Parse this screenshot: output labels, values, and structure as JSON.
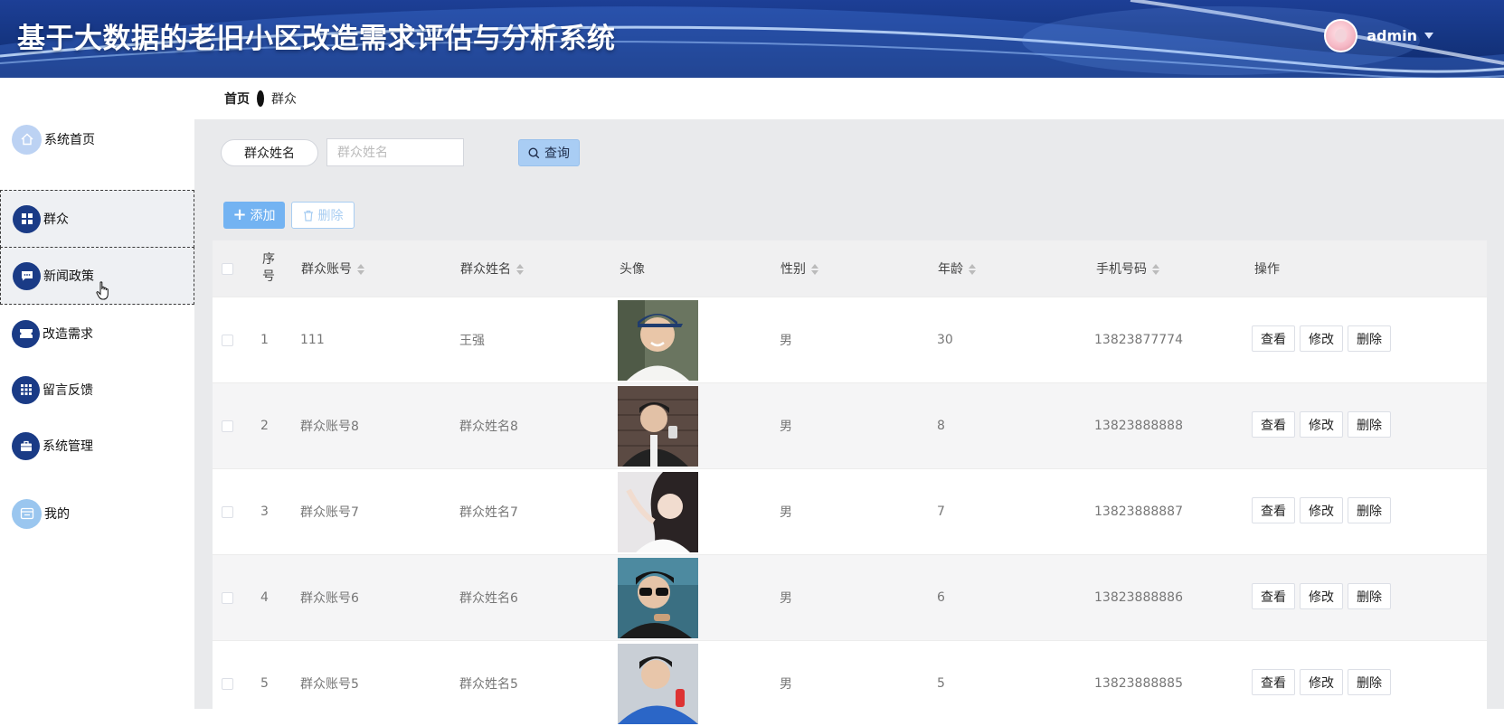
{
  "header": {
    "title": "基于大数据的老旧小区改造需求评估与分析系统",
    "username": "admin"
  },
  "sidebar": {
    "items": [
      {
        "label": "系统首页",
        "icon": "home-icon"
      },
      {
        "label": "群众",
        "icon": "grid-icon"
      },
      {
        "label": "新闻政策",
        "icon": "chat-icon"
      },
      {
        "label": "改造需求",
        "icon": "ticket-icon"
      },
      {
        "label": "留言反馈",
        "icon": "apps-icon"
      },
      {
        "label": "系统管理",
        "icon": "briefcase-icon"
      },
      {
        "label": "我的",
        "icon": "card-icon"
      }
    ]
  },
  "breadcrumb": {
    "home": "首页",
    "current": "群众"
  },
  "search": {
    "label": "群众姓名",
    "placeholder": "群众姓名",
    "value": "",
    "query_label": "查询"
  },
  "toolbar": {
    "add_label": "添加",
    "delete_label": "删除"
  },
  "table": {
    "columns": {
      "seq_top": "序",
      "seq_bottom": "号",
      "account": "群众账号",
      "name": "群众姓名",
      "avatar": "头像",
      "gender": "性别",
      "age": "年龄",
      "phone": "手机号码",
      "actions": "操作"
    },
    "action_labels": {
      "view": "查看",
      "edit": "修改",
      "delete": "删除"
    },
    "rows": [
      {
        "seq": "1",
        "account": "111",
        "name": "王强",
        "gender": "男",
        "age": "30",
        "phone": "13823877774"
      },
      {
        "seq": "2",
        "account": "群众账号8",
        "name": "群众姓名8",
        "gender": "男",
        "age": "8",
        "phone": "13823888888"
      },
      {
        "seq": "3",
        "account": "群众账号7",
        "name": "群众姓名7",
        "gender": "男",
        "age": "7",
        "phone": "13823888887"
      },
      {
        "seq": "4",
        "account": "群众账号6",
        "name": "群众姓名6",
        "gender": "男",
        "age": "6",
        "phone": "13823888886"
      },
      {
        "seq": "5",
        "account": "群众账号5",
        "name": "群众姓名5",
        "gender": "男",
        "age": "5",
        "phone": "13823888885"
      }
    ]
  },
  "colors": {
    "header_bg": "#14347f",
    "menu_icon_bg": "#1a3b86",
    "primary_button": "#73b3f2",
    "content_bg": "#e9eaec"
  }
}
